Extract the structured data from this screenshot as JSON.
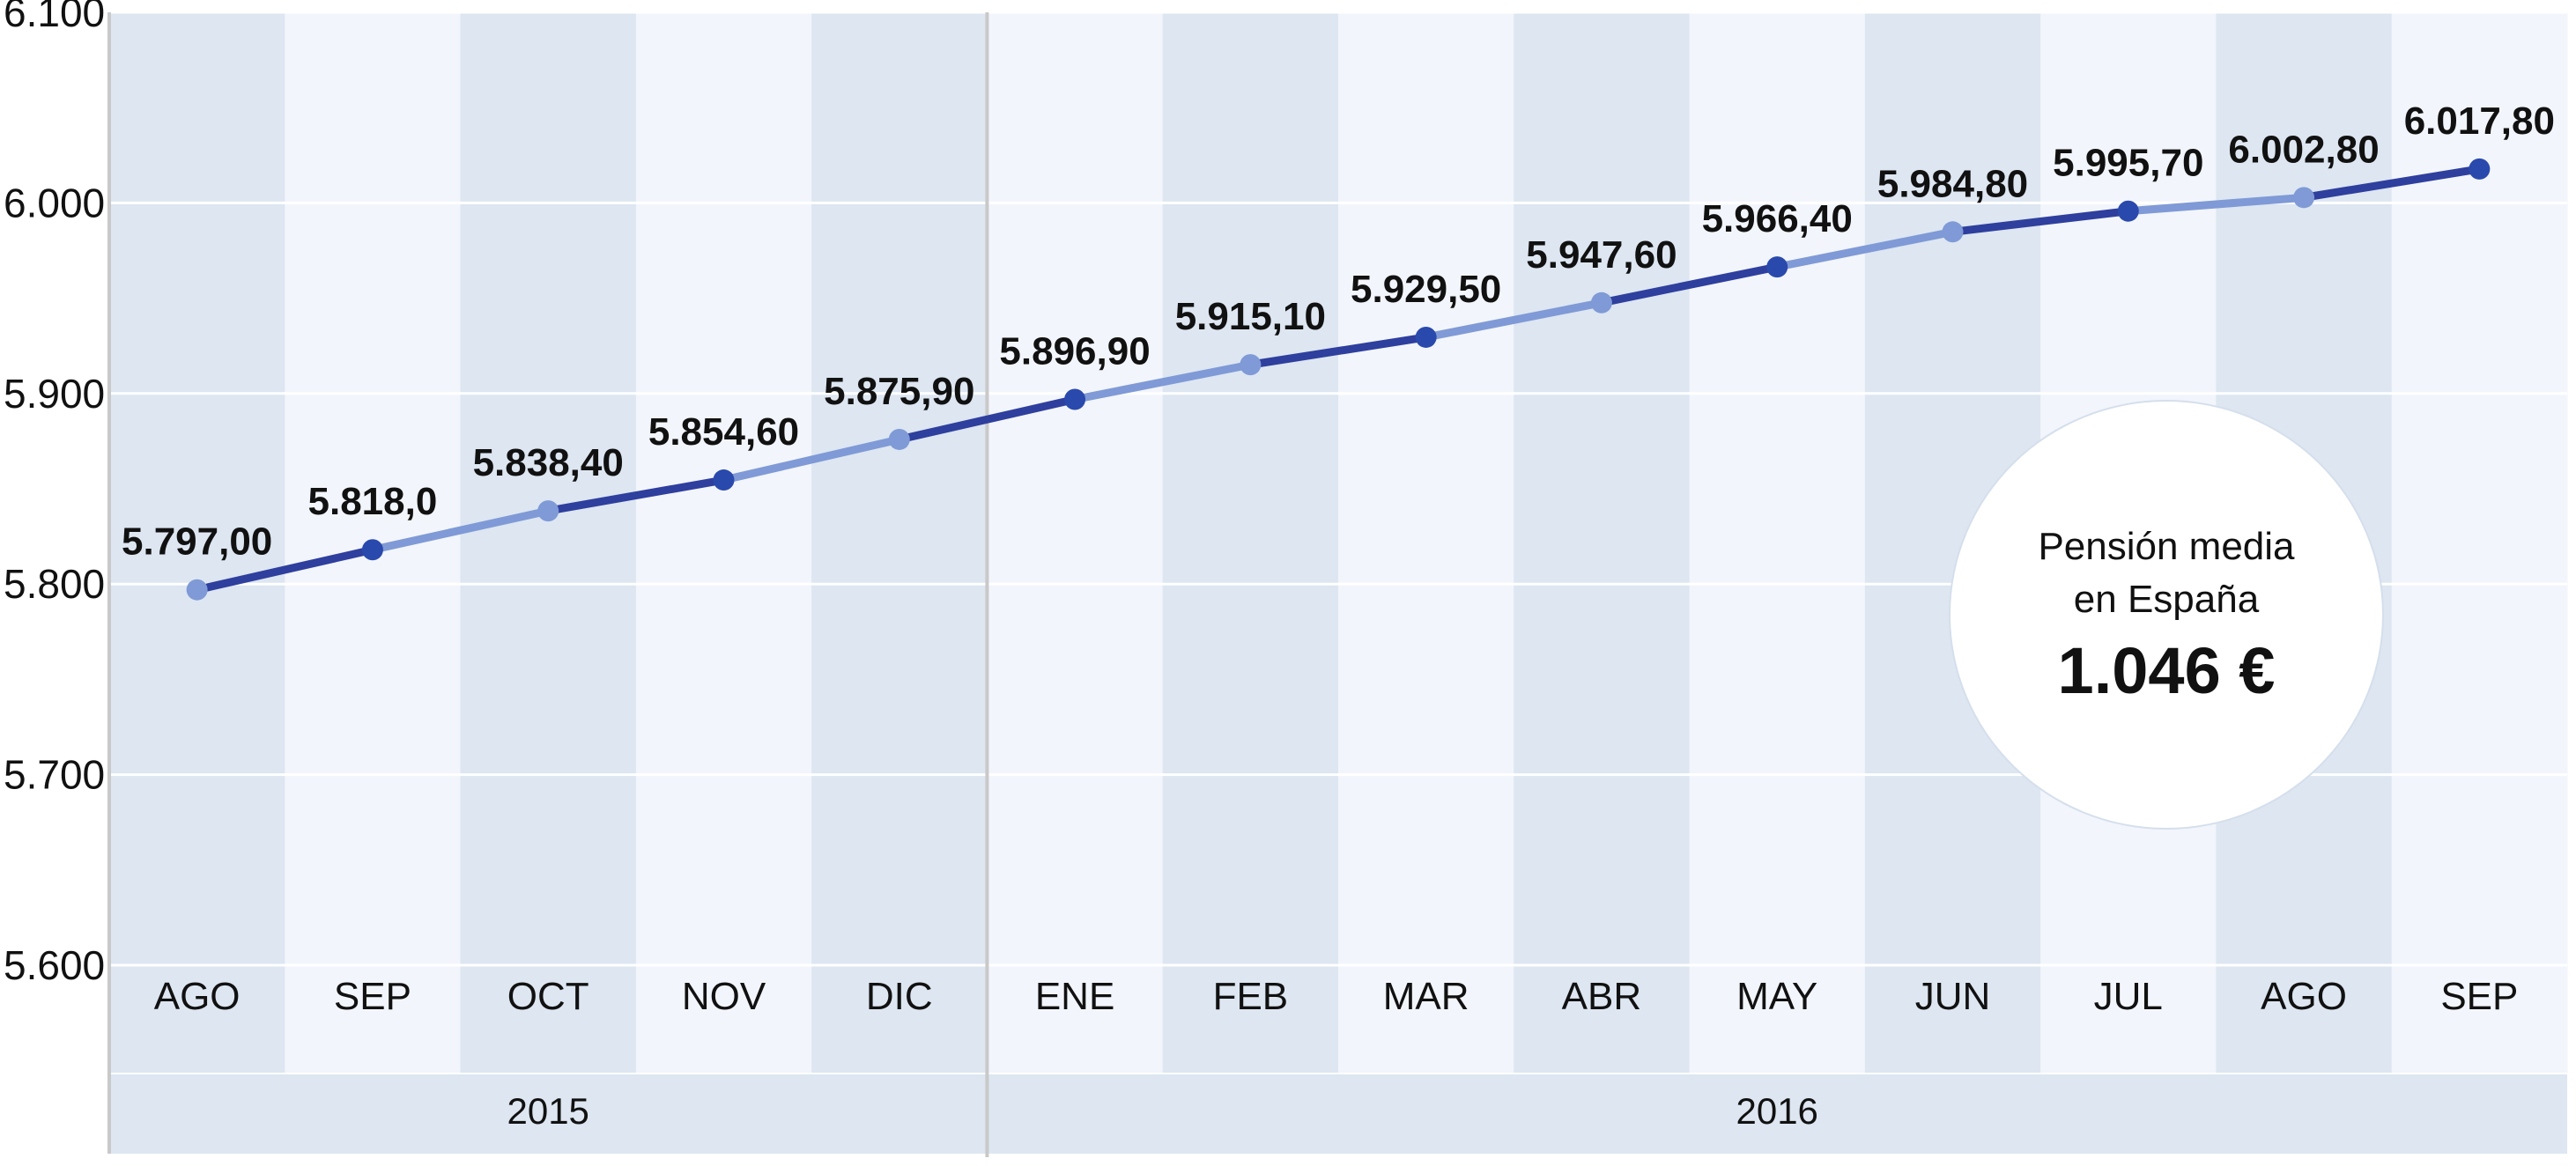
{
  "colors": {
    "band_dark": "#dde6f1",
    "band_light": "#f2f5fb",
    "grid": "#ffffff",
    "line_dark": "#2e3f9e",
    "line_light": "#7f9ad6",
    "point_dark": "#2a49ad",
    "point_light": "#7f9ad6",
    "axis": "#c9c9c9"
  },
  "chart_data": {
    "type": "line",
    "title": "",
    "xlabel": "",
    "ylabel": "",
    "ylim": [
      5600,
      6100
    ],
    "yticks": [
      5600,
      5700,
      5800,
      5900,
      6000,
      6100
    ],
    "ytick_labels": [
      "5.600",
      "5.700",
      "5.800",
      "5.900",
      "6.000",
      "6.100"
    ],
    "grid": true,
    "categories": [
      "AGO",
      "SEP",
      "OCT",
      "NOV",
      "DIC",
      "ENE",
      "FEB",
      "MAR",
      "ABR",
      "MAY",
      "JUN",
      "JUL",
      "AGO",
      "SEP"
    ],
    "years": [
      {
        "label": "2015",
        "from": 0,
        "to": 4
      },
      {
        "label": "2016",
        "from": 5,
        "to": 13
      }
    ],
    "series": [
      {
        "values": [
          5797.0,
          5818.0,
          5838.4,
          5854.6,
          5875.9,
          5896.9,
          5915.1,
          5929.5,
          5947.6,
          5966.4,
          5984.8,
          5995.7,
          6002.8,
          6017.8
        ],
        "labels": [
          "5.797,00",
          "5.818,0",
          "5.838,40",
          "5.854,60",
          "5.875,90",
          "5.896,90",
          "5.915,10",
          "5.929,50",
          "5.947,60",
          "5.966,40",
          "5.984,80",
          "5.995,70",
          "6.002,80",
          "6.017,80"
        ]
      }
    ]
  },
  "callout": {
    "line1": "Pensión media",
    "line2": "en España",
    "value": "1.046 €"
  }
}
